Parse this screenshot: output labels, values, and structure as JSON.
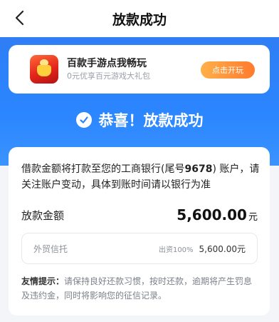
{
  "header": {
    "title": "放款成功",
    "back_icon": "chevron-left-icon"
  },
  "promo": {
    "title": "百款手游点我畅玩",
    "subtitle": "0元优享百元游戏大礼包",
    "button_label": "点击开玩",
    "icon": "gift-game-icon"
  },
  "status": {
    "message": "恭喜！放款成功",
    "icon": "check-circle-icon"
  },
  "detail": {
    "notice": "借款金额将打款至您的工商银行(尾号",
    "card_tail": "9678",
    "notice_after_tail": ") 账户，请关注账户变动，具体到账时间请以银行为准",
    "amount_label": "放款金额",
    "amount_value": "5,600.00",
    "amount_unit": "元",
    "fund": {
      "name": "外贸信托",
      "ratio": "出资100%",
      "amount": "5,600.00元"
    },
    "tips_label": "友情提示：",
    "tips_text": "请保持良好还款习惯，按时还款，逾期将产生罚息及违约金，同时将影响您的征信记录。"
  },
  "colors": {
    "primary_blue": "#2b86ff",
    "button_orange": "#ff7a2e",
    "background": "#f3f5f9"
  }
}
